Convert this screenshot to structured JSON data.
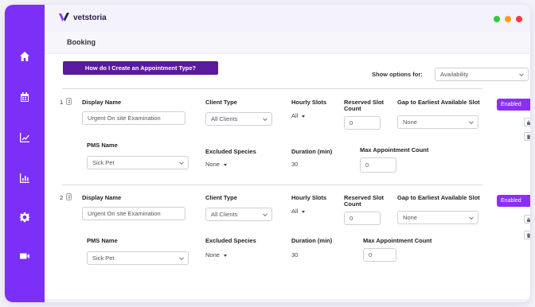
{
  "app": {
    "brand": "vetstoria",
    "accent": "#7b2ff7",
    "traffic_colors": [
      "#2ecc40",
      "#ff9f1a",
      "#ff3b3b"
    ]
  },
  "sidebar": {
    "items": [
      {
        "icon": "home-icon"
      },
      {
        "icon": "calendar-icon"
      },
      {
        "icon": "trend-chart-icon"
      },
      {
        "icon": "bar-chart-icon"
      },
      {
        "icon": "gear-icon"
      },
      {
        "icon": "video-icon"
      }
    ]
  },
  "page": {
    "title": "Booking"
  },
  "toolbar": {
    "help_label": "How do I Create an Appointment Type?",
    "show_options_label": "Show options for:",
    "show_options_value": "Availability"
  },
  "labels": {
    "display_name": "Display Name",
    "client_type": "Client Type",
    "hourly_slots": "Hourly Slots",
    "reserved_slot": "Reserved Slot Count",
    "gap": "Gap to Earliest Available Slot",
    "pms_name": "PMS Name",
    "excluded_species": "Excluded Species",
    "duration": "Duration (min)",
    "max_appt": "Max Appointment Count"
  },
  "rows": [
    {
      "index": "1",
      "display_name": "Urgent On site Examination",
      "client_type": "All Clients",
      "hourly_slots": "All",
      "reserved_slot": "0",
      "gap": "None",
      "pms_name": "Sick Pet",
      "excluded_species": "None",
      "duration": "30",
      "max_appt": "0",
      "toggle": "Enabled"
    },
    {
      "index": "2",
      "display_name": "Urgent On site Examination",
      "client_type": "All Clients",
      "hourly_slots": "All",
      "reserved_slot": "0",
      "gap": "None",
      "pms_name": "Sick Pet",
      "excluded_species": "None",
      "duration": "30",
      "max_appt": "0",
      "toggle": "Enabled"
    }
  ]
}
